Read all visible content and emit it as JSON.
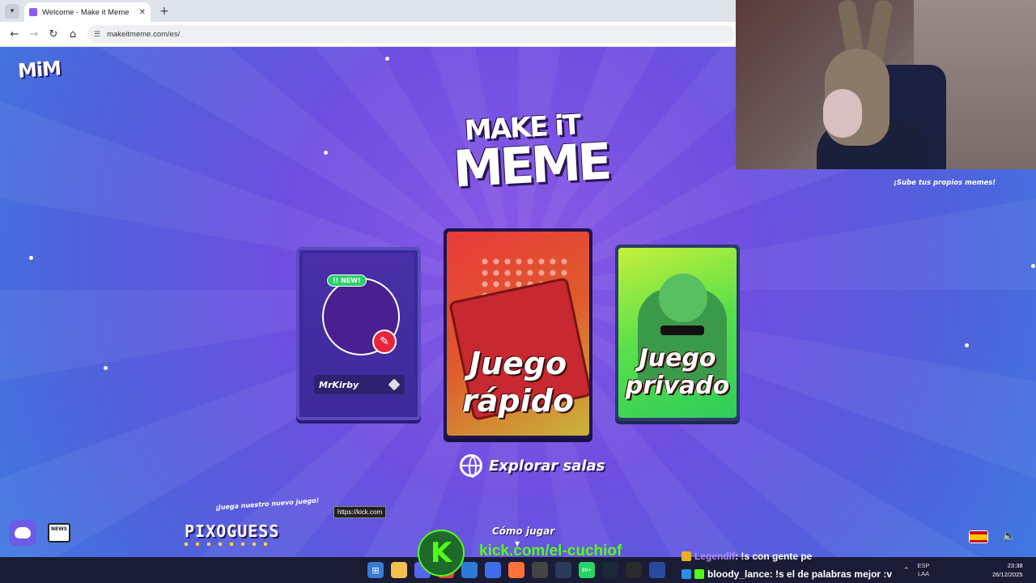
{
  "browser": {
    "tab_title": "Welcome - Make it Meme",
    "url": "makeitmeme.com/es/",
    "new_tab_symbol": "+",
    "close_symbol": "✕"
  },
  "page": {
    "logo_small": "MiM",
    "title_line1": "MAKE iT",
    "title_line2": "MEME",
    "upload_memes": "¡Sube tus propios memes!",
    "profile": {
      "new_badge": "!! NEW!",
      "username": "MrKirby"
    },
    "quick_game": {
      "line1": "Juego",
      "line2": "rápido"
    },
    "private_game": {
      "line1": "Juego",
      "line2": "privado"
    },
    "explore_label": "Explorar salas",
    "promo_text": "¡Juega nuestro nuevo juego!",
    "pixoguess": "PIXOGUESS",
    "tooltip": "https://kick.com",
    "how_to_play": "Cómo jugar",
    "news_label": "NEWS"
  },
  "stream_overlay": {
    "kick_letter": "K",
    "kick_url": "kick.com/el-cuchiof",
    "chat": [
      {
        "user": "Legendlf",
        "message": ": !s con gente pe"
      },
      {
        "user": "bloody_lance",
        "message": ": !s el de palabras mejor :v"
      }
    ]
  },
  "taskbar": {
    "lang_line1": "ESP",
    "lang_line2": "LAA",
    "time": "23:38",
    "date": "26/12/2025",
    "badge_count": "99+"
  },
  "colors": {
    "kick_green": "#53fc18",
    "edit_red": "#e8243c",
    "new_green": "#2bcf6a"
  }
}
